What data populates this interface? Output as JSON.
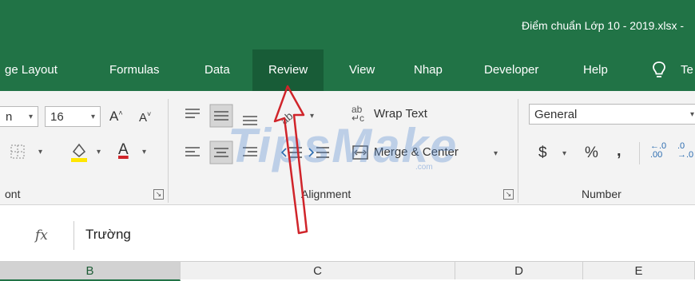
{
  "window": {
    "title": "Điểm chuẩn Lớp 10 - 2019.xlsx  -"
  },
  "tabs": [
    {
      "label": "ge Layout"
    },
    {
      "label": "Formulas"
    },
    {
      "label": "Data"
    },
    {
      "label": "Review"
    },
    {
      "label": "View"
    },
    {
      "label": "Nhap"
    },
    {
      "label": "Developer"
    },
    {
      "label": "Help"
    },
    {
      "label": "Te"
    }
  ],
  "active_tab": "Review",
  "ribbon": {
    "font": {
      "name_partial": "n",
      "size": "16",
      "group_label": "ont"
    },
    "alignment": {
      "wrap_text": "Wrap Text",
      "merge_center": "Merge & Center",
      "group_label": "Alignment"
    },
    "number": {
      "format": "General",
      "currency": "$",
      "percent": "%",
      "comma": ",",
      "inc_decimal": "←.0\n.00",
      "group_label": "Number"
    }
  },
  "formula_bar": {
    "fx_label": "fx",
    "value": "Trường"
  },
  "columns": [
    "B",
    "C",
    "D",
    "E"
  ],
  "watermark": {
    "text": "TipsMake",
    "sub": ".com"
  },
  "colors": {
    "excel_green": "#217346",
    "active_tab": "#185c37",
    "arrow": "#d0242a"
  }
}
